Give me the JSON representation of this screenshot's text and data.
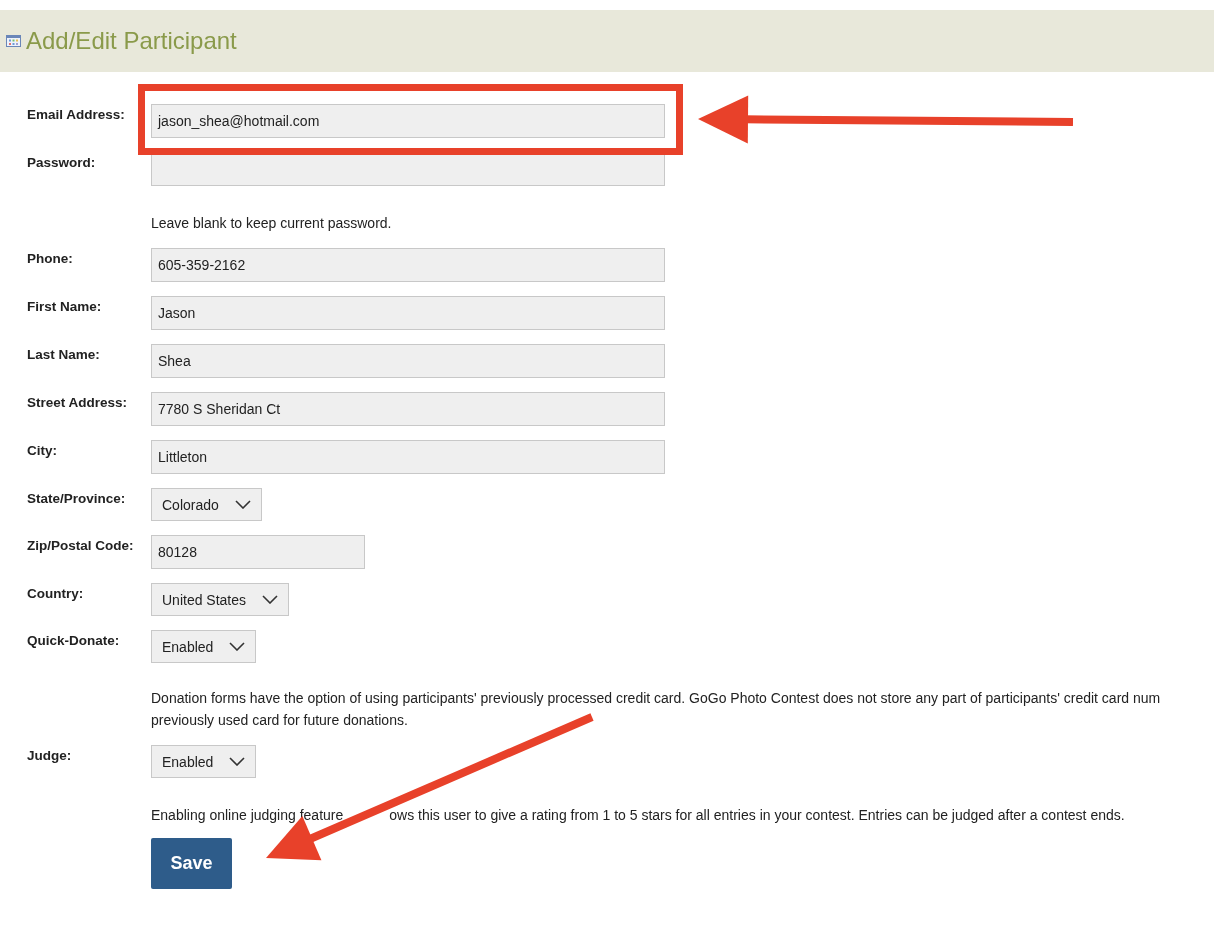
{
  "header": {
    "title": "Add/Edit Participant"
  },
  "fields": [
    {
      "kind": "text",
      "label": "Email Address:",
      "value": "jason_shea@hotmail.com"
    },
    {
      "kind": "text",
      "label": "Password:",
      "hint": "Leave blank to keep current password."
    },
    {
      "kind": "text",
      "label": "Phone:",
      "value": "605-359-2162"
    },
    {
      "kind": "text",
      "label": "First Name:",
      "value": "Jason"
    },
    {
      "kind": "text",
      "label": "Last Name:",
      "value": "Shea"
    },
    {
      "kind": "text",
      "label": "Street Address:",
      "value": "7780 S Sheridan Ct"
    },
    {
      "kind": "text",
      "label": "City:",
      "value": "Littleton"
    },
    {
      "kind": "select",
      "label": "State/Province:",
      "value": "Colorado"
    },
    {
      "kind": "short",
      "label": "Zip/Postal Code:",
      "value": "80128"
    },
    {
      "kind": "select",
      "label": "Country:",
      "value": "United States"
    },
    {
      "kind": "select",
      "label": "Quick-Donate:",
      "value": "Enabled",
      "hint_lines": [
        "Donation forms have the option of using participants' previously processed credit card. GoGo Photo Contest does not store any part of participants' credit card num",
        "previously used card for future donations."
      ]
    },
    {
      "kind": "select",
      "label": "Judge:",
      "value": "Enabled",
      "hint_parts": [
        "Enabling online judging feature",
        "ows this user to give a rating from 1 to 5 stars for all entries in your contest. Entries can be judged after a contest ends."
      ]
    }
  ],
  "save_button": "Save",
  "annotations": [
    {
      "kind": "highlight-box"
    },
    {
      "kind": "arrow"
    },
    {
      "kind": "arrow"
    }
  ]
}
